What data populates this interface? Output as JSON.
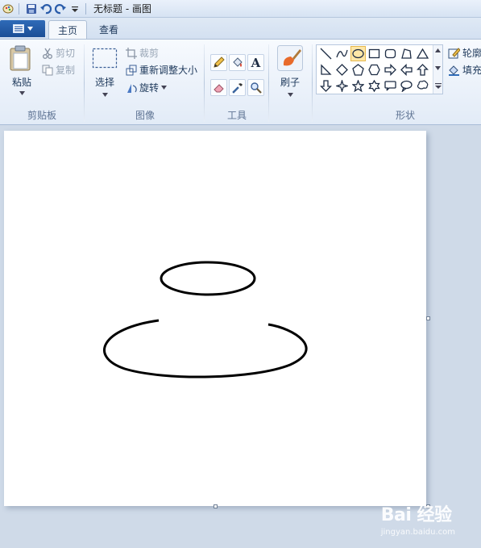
{
  "window": {
    "title": "无标题 - 画图"
  },
  "tabs": [
    {
      "label": "主页",
      "active": true
    },
    {
      "label": "查看",
      "active": false
    }
  ],
  "ribbon": {
    "clipboard": {
      "paste": "粘贴",
      "cut": "剪切",
      "copy": "复制",
      "label": "剪贴板"
    },
    "image": {
      "select": "选择",
      "crop": "裁剪",
      "resize": "重新调整大小",
      "rotate": "旋转",
      "label": "图像"
    },
    "tools": {
      "label": "工具",
      "text_glyph": "A"
    },
    "brushes": {
      "label": "刷子"
    },
    "shapes": {
      "label": "形状",
      "outline": "轮廓",
      "fill": "填充"
    }
  },
  "watermark": {
    "main": "Bai 经验",
    "sub": "jingyan.baidu.com"
  },
  "colors": {
    "accent": "#1b4e96",
    "selected_shape": "#fde6a7",
    "ribbon_bg": "#e2ebf7",
    "workspace": "#cfdae8",
    "canvas": "#ffffff"
  }
}
